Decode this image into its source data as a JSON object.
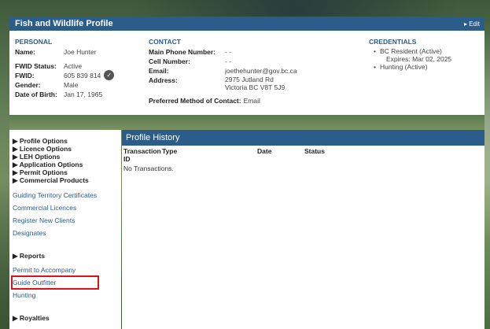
{
  "panel": {
    "title": "Fish and Wildlife Profile",
    "edit": "▸ Edit"
  },
  "personal": {
    "heading": "PERSONAL",
    "name_label": "Name:",
    "name": "Joe Hunter",
    "fwid_status_label": "FWID Status:",
    "fwid_status": "Active",
    "fwid_label": "FWID:",
    "fwid": "605 839 814",
    "gender_label": "Gender:",
    "gender": "Male",
    "dob_label": "Date of Birth:",
    "dob": "Jan 17, 1965"
  },
  "contact": {
    "heading": "CONTACT",
    "main_phone_label": "Main Phone Number:",
    "main_phone": "- -",
    "cell_label": "Cell Number:",
    "cell": "- -",
    "email_label": "Email:",
    "email": "joethehunter@gov.bc.ca",
    "address_label": "Address:",
    "address_line1": "2975 Jutland Rd",
    "address_line2": "Victoria BC V8T 5J9",
    "preferred_label": "Preferred Method of Contact:",
    "preferred": "Email"
  },
  "credentials": {
    "heading": "CREDENTIALS",
    "items": [
      {
        "label": "BC Resident (Active)",
        "sub": "Expires: Mar 02, 2025"
      },
      {
        "label": "Hunting (Active)"
      }
    ]
  },
  "nav": {
    "groups": [
      "▶ Profile Options",
      "▶ Licence Options",
      "▶ LEH Options",
      "▶ Application Options",
      "▶ Permit Options",
      "▶ Commercial Products"
    ],
    "commercial_links": [
      "Guiding Territory Certificates",
      "Commercial Licences",
      "Register New Clients",
      "Designates"
    ],
    "reports_heading": "▶ Reports",
    "report_links": [
      "Permit to Accompany",
      "Guide Outfitter",
      "Hunting"
    ],
    "royalties_heading": "▶ Royalties"
  },
  "history": {
    "title": "Profile History",
    "columns": [
      "Transaction ID",
      "Type",
      "Date",
      "Status"
    ],
    "empty": "No Transactions."
  },
  "colors": {
    "header": "#2b5c8a",
    "highlight": "#e0101a"
  }
}
